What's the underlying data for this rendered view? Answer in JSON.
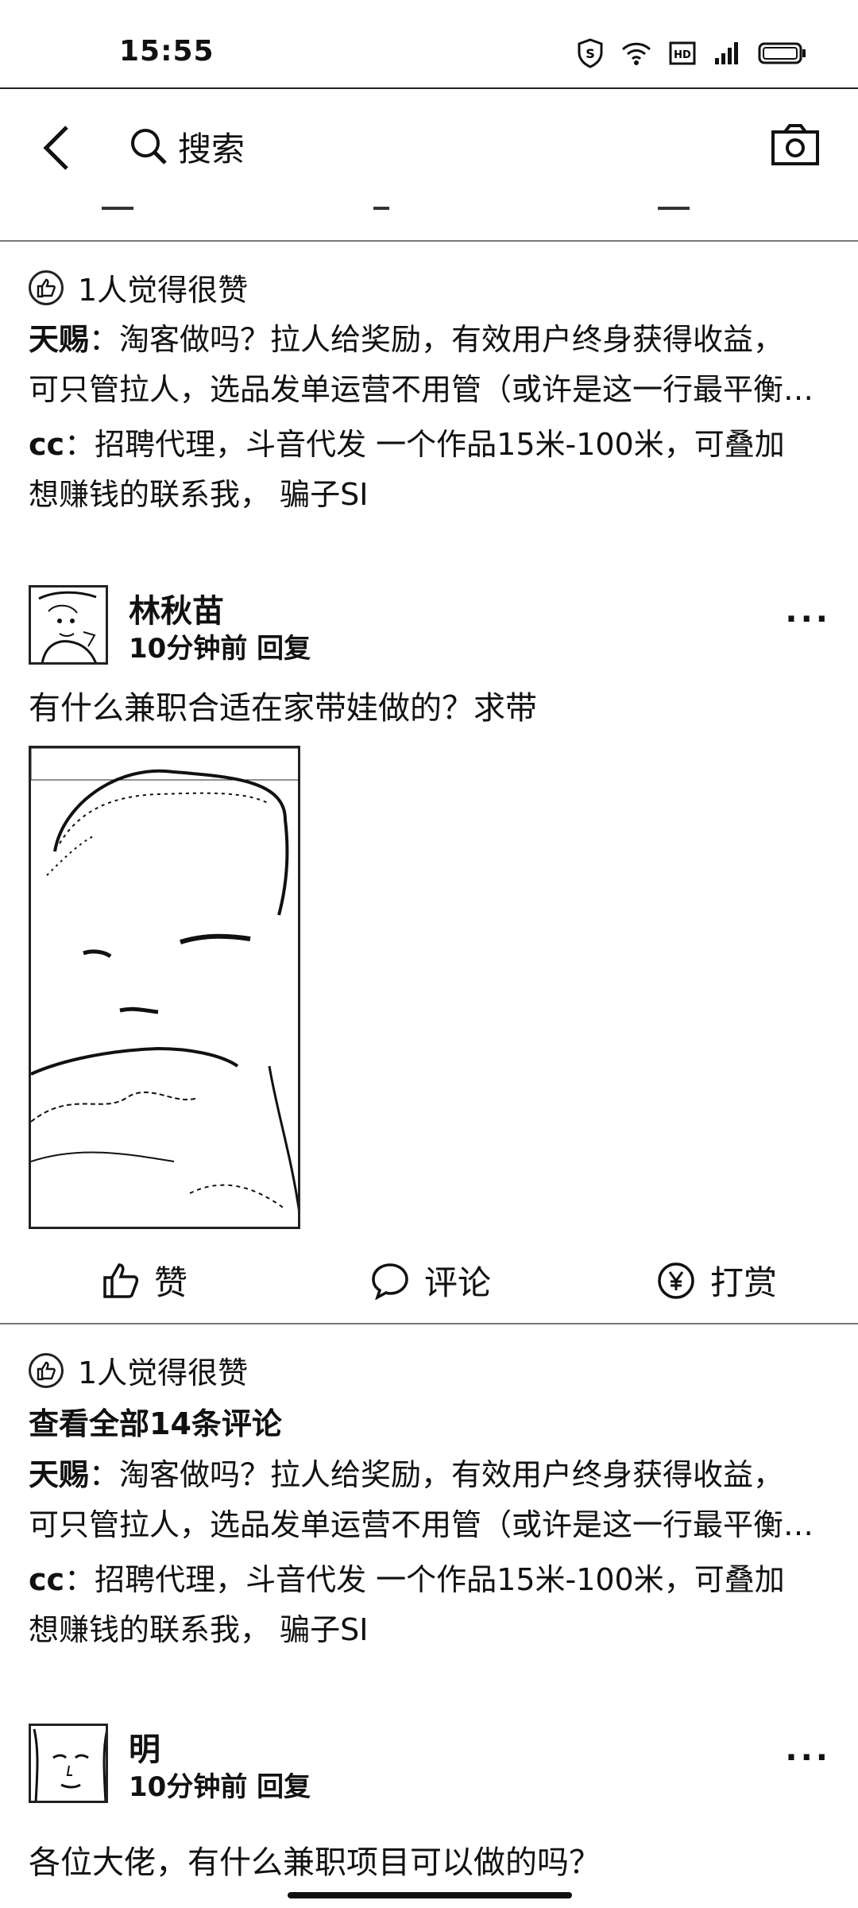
{
  "status_bar": {
    "time": "15:55",
    "icons": [
      "shield-icon",
      "wifi-icon",
      "hd-icon",
      "signal-icon",
      "battery-icon"
    ]
  },
  "nav": {
    "search_label": "搜索"
  },
  "block1": {
    "likes_text": "1人觉得很赞",
    "comments": [
      {
        "author": "天赐",
        "text": "：淘客做吗？拉人给奖励，有效用户终身获得收益，",
        "cont": "可只管拉人，选品发单运营不用管（或许是这一行最平衡…"
      },
      {
        "author": "cc",
        "text": "：招聘代理，斗音代发 一个作品15米-100米，可叠加",
        "cont": "想赚钱的联系我， 骗子SI"
      }
    ]
  },
  "post1": {
    "author": "林秋苗",
    "meta": "10分钟前 回复",
    "more": "···",
    "text": "有什么兼职合适在家带娃做的？求带",
    "actions": {
      "like": "赞",
      "comment": "评论",
      "reward": "打赏"
    }
  },
  "block2": {
    "likes_text": "1人觉得很赞",
    "view_all": "查看全部14条评论",
    "comments": [
      {
        "author": "天赐",
        "text": "：淘客做吗？拉人给奖励，有效用户终身获得收益，",
        "cont": "可只管拉人，选品发单运营不用管（或许是这一行最平衡…"
      },
      {
        "author": "cc",
        "text": "：招聘代理，斗音代发 一个作品15米-100米，可叠加",
        "cont": "想赚钱的联系我， 骗子SI"
      }
    ]
  },
  "post2": {
    "author": "明",
    "meta": "10分钟前 回复",
    "more": "···",
    "text": "各位大佬，有什么兼职项目可以做的吗？"
  }
}
